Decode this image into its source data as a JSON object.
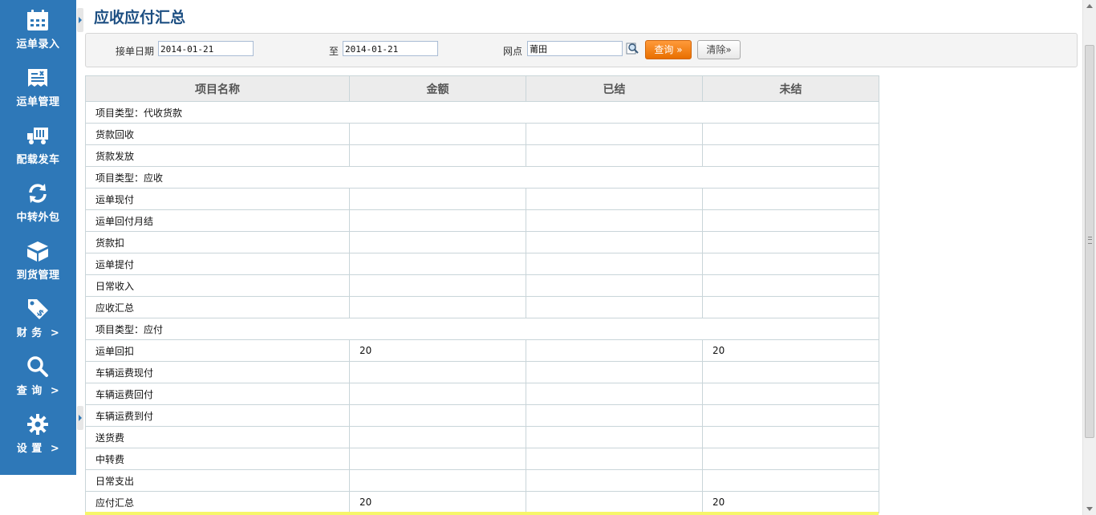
{
  "sidebar": {
    "items": [
      {
        "label": "运单录入",
        "icon": "calendar-icon"
      },
      {
        "label": "运单管理",
        "icon": "waybill-list-icon"
      },
      {
        "label": "配载发车",
        "icon": "truck-icon"
      },
      {
        "label": "中转外包",
        "icon": "refresh-icon"
      },
      {
        "label": "到货管理",
        "icon": "box-icon"
      },
      {
        "label": "财 务  >",
        "icon": "price-tag-icon"
      },
      {
        "label": "查 询  >",
        "icon": "search-icon"
      },
      {
        "label": "设 置  >",
        "icon": "gear-icon"
      }
    ],
    "color": "#2e78b8"
  },
  "page": {
    "title": "应收应付汇总"
  },
  "filter": {
    "date_label": "接单日期",
    "date_from": "2014-01-21",
    "to_label": "至",
    "date_to": "2014-01-21",
    "outlet_label": "网点",
    "outlet_value": "莆田",
    "query_label": "查询 »",
    "clear_label": "清除»"
  },
  "table": {
    "headers": [
      "项目名称",
      "金额",
      "已结",
      "未结"
    ],
    "rows": [
      {
        "type": "group-dark",
        "name": "项目类型：代收货款",
        "amount": "",
        "settled": "",
        "unsettled": ""
      },
      {
        "type": "item",
        "name": "货款回收",
        "amount": "",
        "settled": "",
        "unsettled": ""
      },
      {
        "type": "item",
        "name": "货款发放",
        "amount": "",
        "settled": "",
        "unsettled": ""
      },
      {
        "type": "group-blue",
        "name": "项目类型：应收",
        "amount": "",
        "settled": "",
        "unsettled": ""
      },
      {
        "type": "item",
        "name": "运单现付",
        "amount": "",
        "settled": "",
        "unsettled": ""
      },
      {
        "type": "item",
        "name": "运单回付月结",
        "amount": "",
        "settled": "",
        "unsettled": ""
      },
      {
        "type": "item",
        "name": "货款扣",
        "amount": "",
        "settled": "",
        "unsettled": ""
      },
      {
        "type": "item",
        "name": "运单提付",
        "amount": "",
        "settled": "",
        "unsettled": ""
      },
      {
        "type": "item",
        "name": "日常收入",
        "amount": "",
        "settled": "",
        "unsettled": ""
      },
      {
        "type": "subtotal",
        "name": "应收汇总",
        "amount": "",
        "settled": "",
        "unsettled": ""
      },
      {
        "type": "group-blue",
        "name": "项目类型：应付",
        "amount": "",
        "settled": "",
        "unsettled": ""
      },
      {
        "type": "item",
        "name": "运单回扣",
        "amount": "20",
        "settled": "",
        "unsettled": "20"
      },
      {
        "type": "item",
        "name": "车辆运费现付",
        "amount": "",
        "settled": "",
        "unsettled": ""
      },
      {
        "type": "item",
        "name": "车辆运费回付",
        "amount": "",
        "settled": "",
        "unsettled": ""
      },
      {
        "type": "item",
        "name": "车辆运费到付",
        "amount": "",
        "settled": "",
        "unsettled": ""
      },
      {
        "type": "item",
        "name": "送货费",
        "amount": "",
        "settled": "",
        "unsettled": ""
      },
      {
        "type": "item",
        "name": "中转费",
        "amount": "",
        "settled": "",
        "unsettled": ""
      },
      {
        "type": "item",
        "name": "日常支出",
        "amount": "",
        "settled": "",
        "unsettled": ""
      },
      {
        "type": "subtotal",
        "name": "应付汇总",
        "amount": "20",
        "settled": "",
        "unsettled": "20"
      }
    ]
  },
  "colors": {
    "group_dark": "#5a8694",
    "group_blue": "#00b8ff",
    "subtotal": "#ffb967",
    "query_button": "#f08010"
  }
}
